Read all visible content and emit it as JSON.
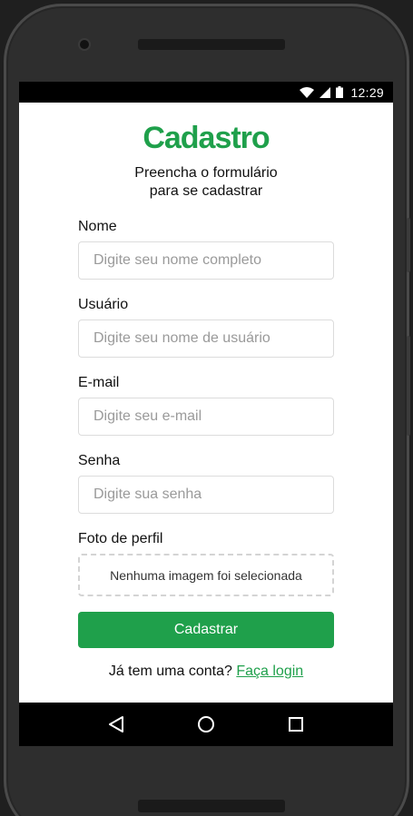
{
  "status_bar": {
    "time": "12:29",
    "icons": [
      "wifi-icon",
      "signal-icon",
      "battery-icon"
    ]
  },
  "form": {
    "title": "Cadastro",
    "subtitle_line1": "Preencha o formulário",
    "subtitle_line2": "para se cadastrar",
    "fields": [
      {
        "label": "Nome",
        "placeholder": "Digite seu nome completo",
        "value": ""
      },
      {
        "label": "Usuário",
        "placeholder": "Digite seu nome de usuário",
        "value": ""
      },
      {
        "label": "E-mail",
        "placeholder": "Digite seu e-mail",
        "value": ""
      },
      {
        "label": "Senha",
        "placeholder": "Digite sua senha",
        "value": ""
      }
    ],
    "photo_label": "Foto de perfil",
    "photo_placeholder": "Nenhuma imagem foi selecionada",
    "submit_label": "Cadastrar",
    "login_prompt": "Já tem uma conta?",
    "login_link": "Faça login"
  },
  "nav_bar": {
    "icons": [
      "back-icon",
      "home-icon",
      "recents-icon"
    ]
  },
  "colors": {
    "accent": "#1fa04b",
    "background": "#ffffff",
    "frame": "#2e2e2e"
  }
}
